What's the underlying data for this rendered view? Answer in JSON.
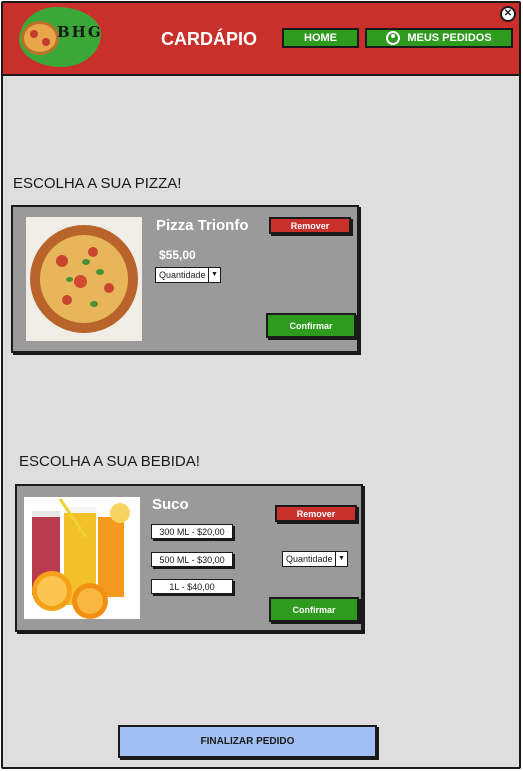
{
  "header": {
    "logo_text": "BHG",
    "title": "CARDÁPIO",
    "nav": {
      "home_label": "HOME",
      "orders_label": "MEUS PEDIDOS"
    },
    "close_glyph": "✕",
    "colors": {
      "header": "#c9302c",
      "nav_button": "#2e9a1e",
      "logo": "#3aa836"
    }
  },
  "pizza_section": {
    "heading": "ESCOLHA A SUA PIZZA!",
    "product": {
      "name": "Pizza Trionfo",
      "price": "$55,00",
      "quantity_placeholder": "Quantidade",
      "remove_label": "Remover",
      "confirm_label": "Confirmar",
      "image": "pizza-photo"
    }
  },
  "drink_section": {
    "heading": "ESCOLHA A SUA BEBIDA!",
    "product": {
      "name": "Suco",
      "sizes": [
        "300  ML - $20,00",
        "500  ML - $30,00",
        "1L - $40,00"
      ],
      "quantity_placeholder": "Quantidade",
      "remove_label": "Remover",
      "confirm_label": "Confirmar",
      "image": "juice-photo"
    }
  },
  "footer": {
    "finish_label": "FINALIZAR PEDIDO",
    "finish_color": "#a2bff3"
  }
}
